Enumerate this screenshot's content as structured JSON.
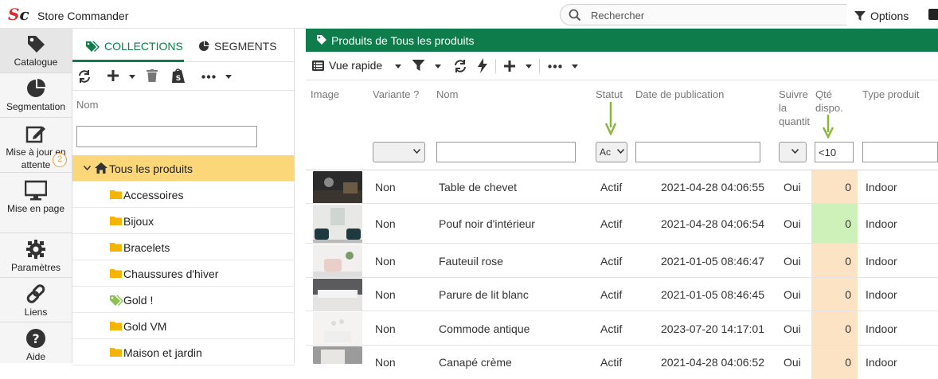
{
  "app": {
    "title": "Store Commander",
    "logo_s": "S",
    "logo_c": "c"
  },
  "search": {
    "placeholder": "Rechercher"
  },
  "top": {
    "options_label": "Options"
  },
  "nav": {
    "items": [
      {
        "label": "Catalogue"
      },
      {
        "label": "Segmentation"
      },
      {
        "label": "Mise à jour en attente",
        "badge": "2"
      },
      {
        "label": "Mise en page"
      },
      {
        "label": "Paramètres"
      },
      {
        "label": "Liens"
      },
      {
        "label": "Aide"
      }
    ]
  },
  "collections": {
    "tabs": [
      {
        "label": "COLLECTIONS"
      },
      {
        "label": "SEGMENTS"
      }
    ],
    "column_header": "Nom",
    "filter_value": "",
    "tree": [
      {
        "label": "Tous les produits",
        "icon": "home-icon"
      },
      {
        "label": "Accessoires",
        "icon": "folder-icon"
      },
      {
        "label": "Bijoux",
        "icon": "folder-icon"
      },
      {
        "label": "Bracelets",
        "icon": "folder-icon"
      },
      {
        "label": "Chaussures d'hiver",
        "icon": "folder-icon"
      },
      {
        "label": "Gold !",
        "icon": "tags-icon"
      },
      {
        "label": "Gold VM",
        "icon": "folder-icon"
      },
      {
        "label": "Maison et jardin",
        "icon": "folder-icon"
      }
    ]
  },
  "main": {
    "header_title": "Produits de Tous les produits",
    "view_label": "Vue rapide",
    "columns": {
      "image": "Image",
      "variante": "Variante ?",
      "nom": "Nom",
      "statut": "Statut",
      "date": "Date de publication",
      "suivre_1": "Suivre",
      "suivre_2": "la",
      "suivre_3": "quantit",
      "qte_1": "Qté",
      "qte_2": "dispo.",
      "type": "Type produit"
    },
    "filters": {
      "statut_value": "Ac",
      "qte_value": "<10"
    },
    "rows": [
      {
        "variante": "Non",
        "nom": "Table de chevet",
        "statut": "Actif",
        "date": "2021-04-28 04:06:55",
        "suivre": "Oui",
        "qte": "0",
        "qte_color": "orange",
        "type": "Indoor"
      },
      {
        "variante": "Non",
        "nom": "Pouf noir d'intérieur",
        "statut": "Actif",
        "date": "2021-04-28 04:06:54",
        "suivre": "Oui",
        "qte": "0",
        "qte_color": "green",
        "type": "Indoor"
      },
      {
        "variante": "Non",
        "nom": "Fauteuil rose",
        "statut": "Actif",
        "date": "2021-01-05 08:46:47",
        "suivre": "Oui",
        "qte": "0",
        "qte_color": "orange",
        "type": "Indoor"
      },
      {
        "variante": "Non",
        "nom": "Parure de lit blanc",
        "statut": "Actif",
        "date": "2021-01-05 08:46:45",
        "suivre": "Oui",
        "qte": "0",
        "qte_color": "orange",
        "type": "Indoor"
      },
      {
        "variante": "Non",
        "nom": "Commode antique",
        "statut": "Actif",
        "date": "2023-07-20 14:17:01",
        "suivre": "Oui",
        "qte": "0",
        "qte_color": "orange",
        "type": "Indoor"
      },
      {
        "variante": "Non",
        "nom": "Canapé crème",
        "statut": "Actif",
        "date": "2021-04-28 04:06:52",
        "suivre": "Oui",
        "qte": "0",
        "qte_color": "orange",
        "type": "Indoor"
      }
    ]
  },
  "colors": {
    "accent": "#0e7d4b",
    "selected": "#fbd77a",
    "qty_orange": "#fbe3c4",
    "qty_green": "#cdf1b9",
    "arrow": "#8ab73a",
    "logo_red": "#d32f2f"
  }
}
